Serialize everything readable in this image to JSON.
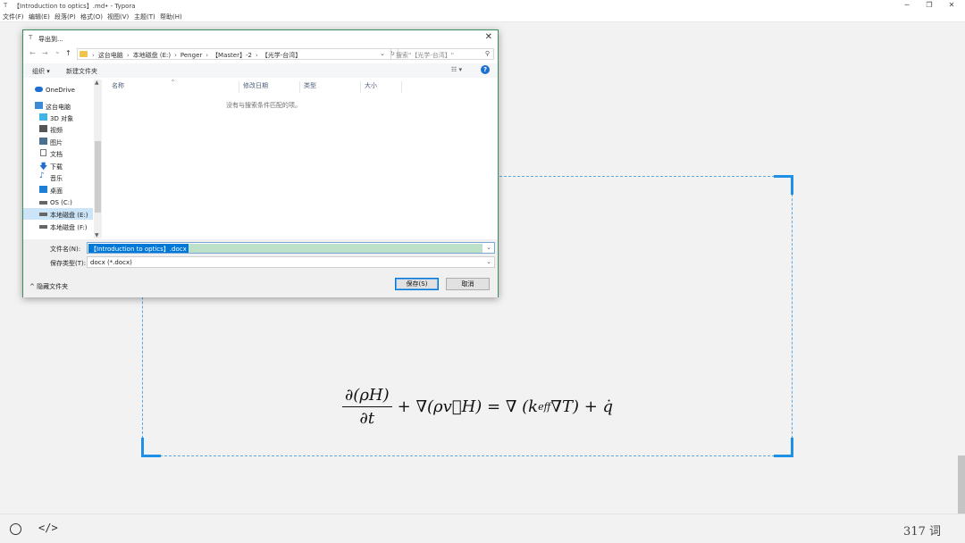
{
  "window": {
    "title": "【Introduction to optics】.md• - Typora",
    "app_icon": "T",
    "minimize": "─",
    "maximize": "❐",
    "close": "✕"
  },
  "menu": [
    "文件(F)",
    "编辑(E)",
    "段落(P)",
    "格式(O)",
    "视图(V)",
    "主题(T)",
    "帮助(H)"
  ],
  "dialog": {
    "title": "导出到...",
    "icon": "T",
    "close": "✕",
    "nav": {
      "back": "←",
      "forward": "→",
      "recent": "⌄",
      "up": "↑"
    },
    "breadcrumbs": [
      "这台电脑",
      "本地磁盘 (E:)",
      "Penger",
      "【Master】-2",
      "【光学-台湾】"
    ],
    "separator": "›",
    "search_placeholder": "搜索\"【光学-台湾】\"",
    "toolbar": {
      "organize": "组织 ▾",
      "new_folder": "新建文件夹",
      "view": "☷ ▾",
      "help": "?"
    },
    "nav_items": [
      {
        "label": "OneDrive",
        "icon": "cloud-icon"
      },
      {
        "label": "这台电脑",
        "icon": "computer-icon"
      },
      {
        "label": "3D 对象",
        "icon": "cube-icon"
      },
      {
        "label": "视频",
        "icon": "video-icon"
      },
      {
        "label": "图片",
        "icon": "picture-icon"
      },
      {
        "label": "文档",
        "icon": "document-icon"
      },
      {
        "label": "下载",
        "icon": "download-icon"
      },
      {
        "label": "音乐",
        "icon": "music-icon"
      },
      {
        "label": "桌面",
        "icon": "desktop-icon"
      },
      {
        "label": "OS (C:)",
        "icon": "drive-icon"
      },
      {
        "label": "本地磁盘 (E:)",
        "icon": "drive-icon",
        "selected": true
      },
      {
        "label": "本地磁盘 (F:)",
        "icon": "drive-icon"
      }
    ],
    "columns": [
      "名称",
      "修改日期",
      "类型",
      "大小"
    ],
    "empty_message": "没有与搜索条件匹配的项。",
    "filename_label": "文件名(N):",
    "filename_value": "【Introduction to optics】.docx",
    "filetype_label": "保存类型(T):",
    "filetype_value": "docx (*.docx)",
    "hide_folders": "隐藏文件夹",
    "save_button": "保存(S)",
    "cancel_button": "取消"
  },
  "equation": {
    "numerator": "∂(ρH)",
    "denominator": "∂t",
    "rest": "+ ∇(ρv⃗H) = ∇ (k",
    "subscript": "eff",
    "rest2": "∇T) + q̇"
  },
  "status": {
    "word_count": "317 词",
    "source_toggle": "</>"
  },
  "colors": {
    "accent": "#1e90e6",
    "dialog_border": "#3c8f5c",
    "selection": "#0078d7"
  }
}
